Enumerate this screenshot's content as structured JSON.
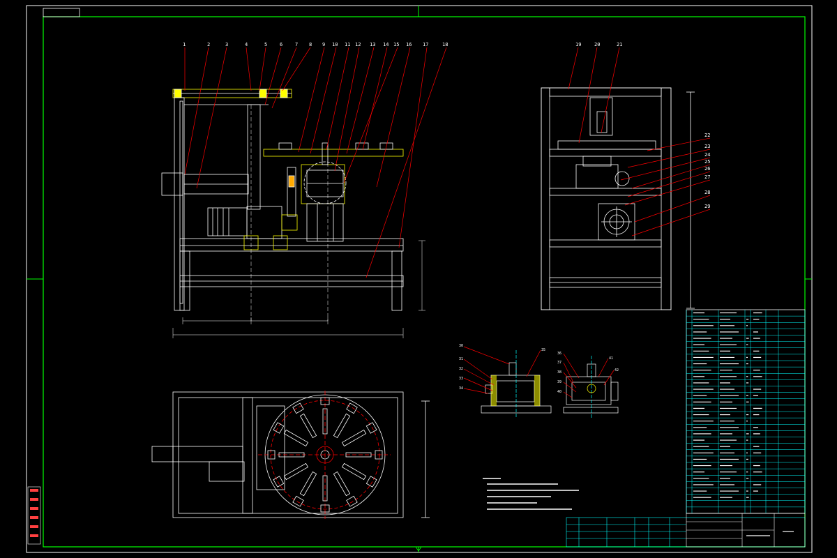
{
  "drawing": {
    "background": "#000000",
    "colors": {
      "frame": "#00ff00",
      "outline": "#ffffff",
      "leader": "#ff0000",
      "table_grid": "#00ffff",
      "hatch": "#ffff00",
      "title_block_side": "#ff0000"
    }
  },
  "front_view_balloons": [
    "1",
    "2",
    "3",
    "4",
    "5",
    "6",
    "7",
    "8",
    "9",
    "10",
    "11",
    "12",
    "13",
    "14",
    "15",
    "16",
    "17",
    "18"
  ],
  "side_view_balloons": [
    "19",
    "20",
    "21"
  ],
  "side_right_balloons": [
    "22",
    "23",
    "24",
    "25",
    "26",
    "27",
    "28",
    "29"
  ],
  "detail_left_balloons": [
    "30",
    "31",
    "32",
    "33",
    "34",
    "35"
  ],
  "detail_right_balloons": [
    "36",
    "37",
    "38",
    "39",
    "40",
    "41",
    "42"
  ]
}
